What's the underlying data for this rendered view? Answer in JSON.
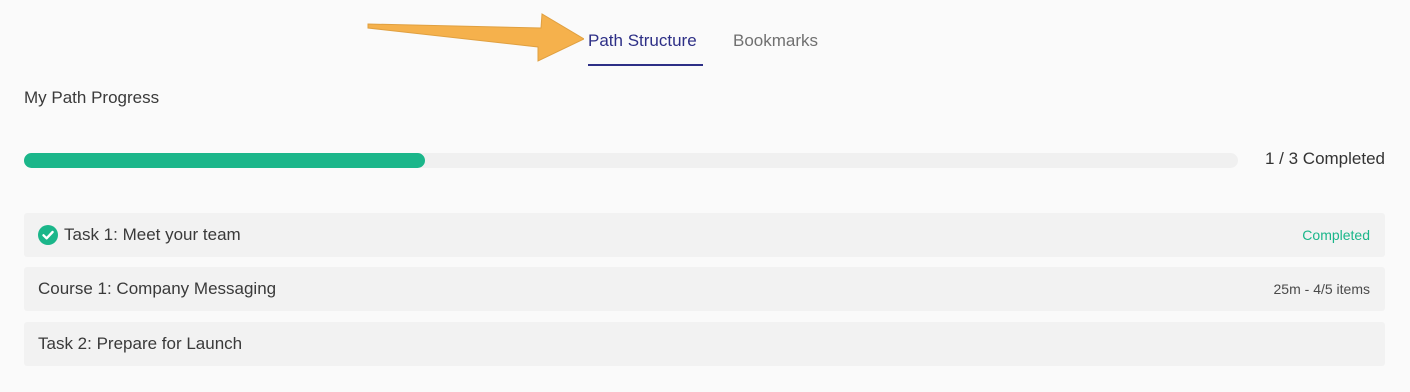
{
  "tabs": [
    {
      "label": "Path Structure",
      "active": true
    },
    {
      "label": "Bookmarks",
      "active": false
    }
  ],
  "progress": {
    "title": "My Path Progress",
    "completed": 1,
    "total": 3,
    "fill_fraction": 0.33,
    "label": "1 / 3 Completed"
  },
  "items": [
    {
      "title": "Task 1: Meet your team",
      "status": "Completed",
      "icon": "check-circle-icon"
    },
    {
      "title": "Course 1: Company Messaging",
      "status": "25m - 4/5 items"
    },
    {
      "title": "Task 2: Prepare for Launch",
      "status": ""
    }
  ],
  "colors": {
    "accent": "#2d2f86",
    "success": "#1bb68a",
    "annotation": "#f5b14c"
  }
}
